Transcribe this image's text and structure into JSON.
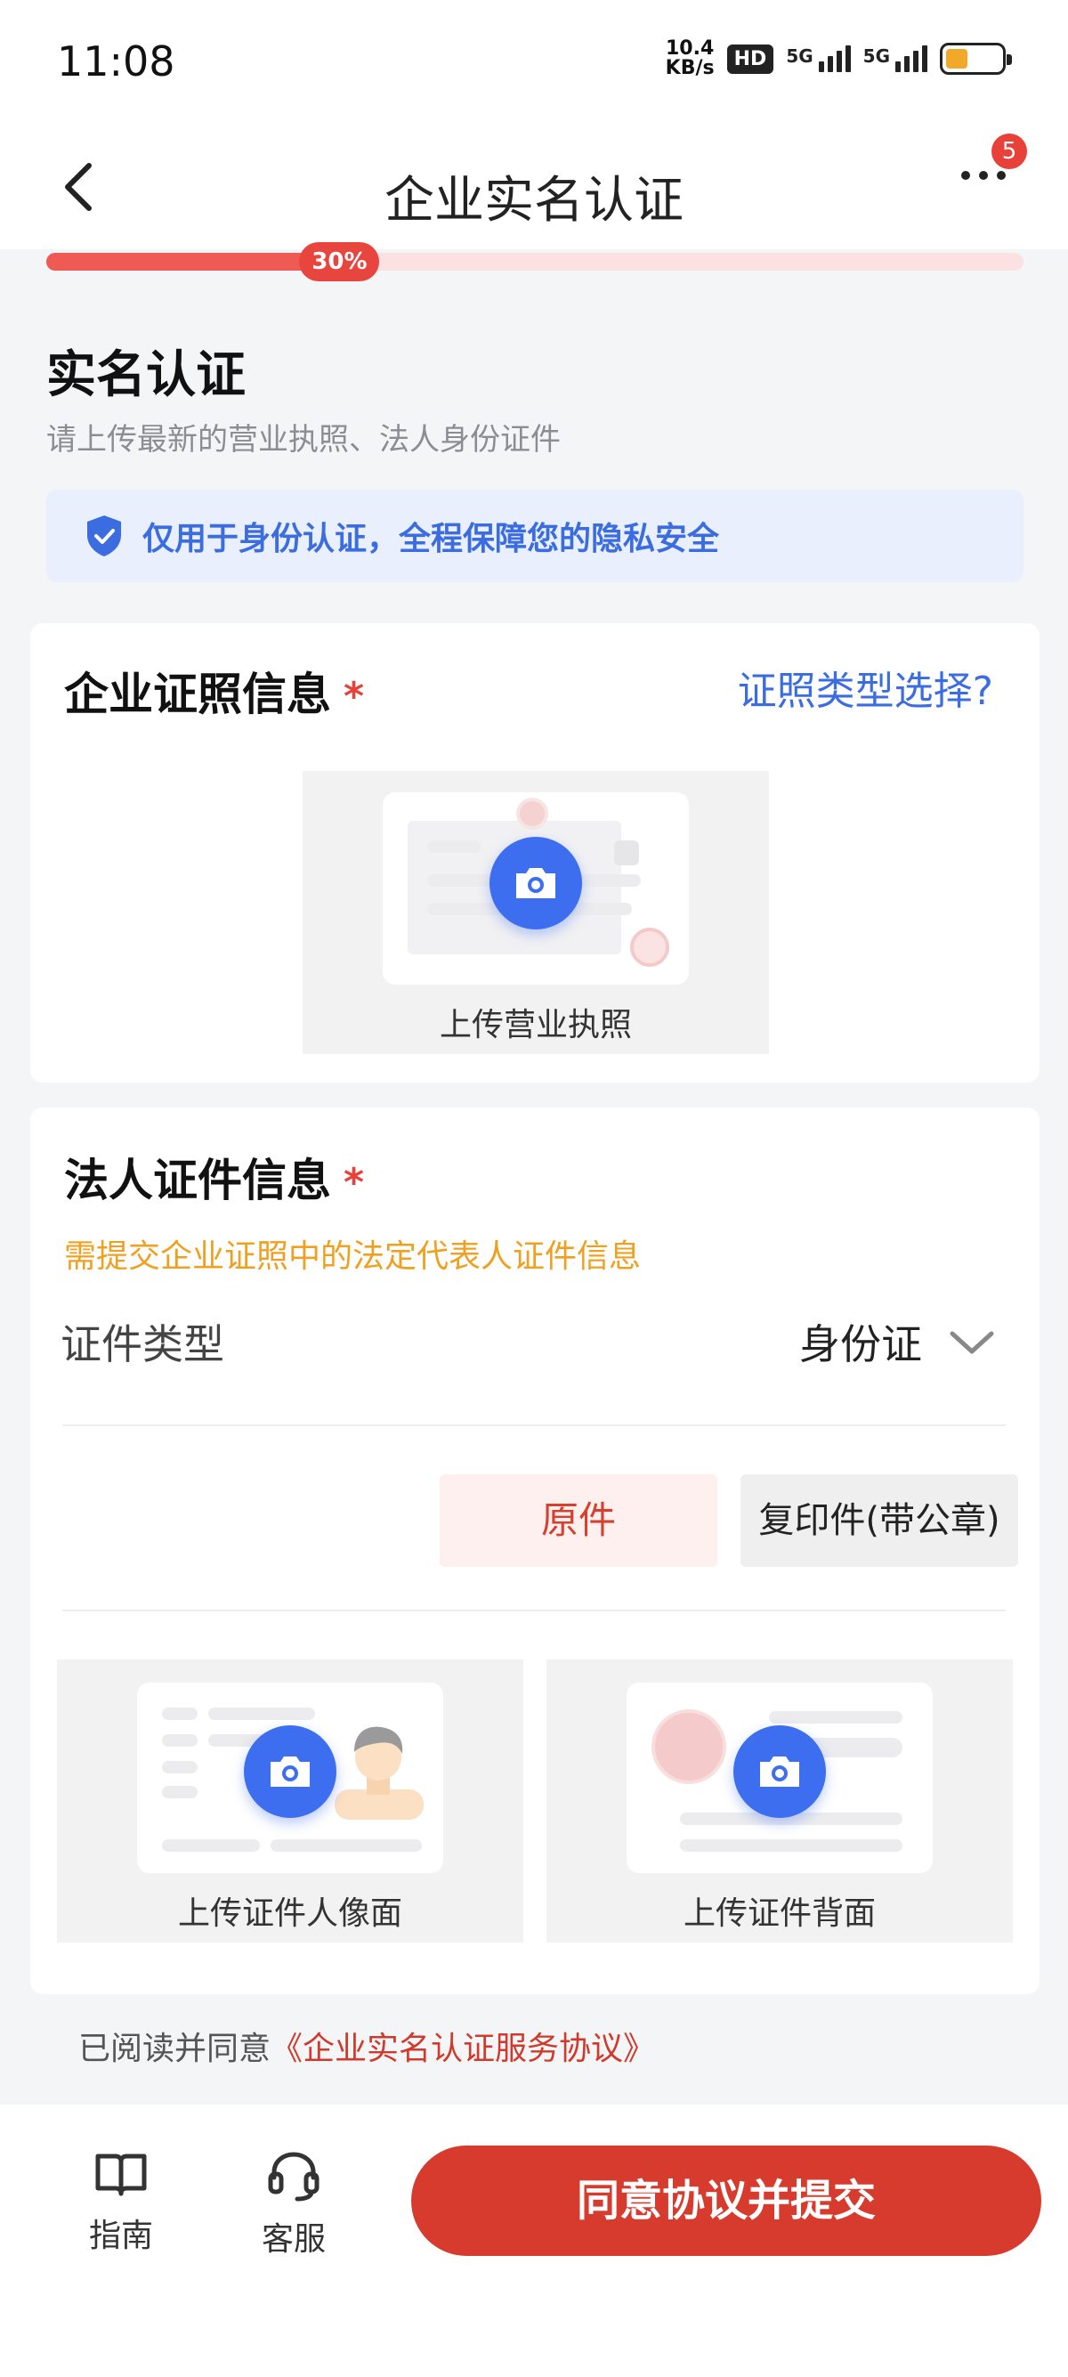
{
  "status_bar": {
    "time": "11:08",
    "net_speed_value": "10.4",
    "net_speed_unit": "KB/s",
    "hd_badge": "HD",
    "signal_1_label": "5G",
    "signal_2_label": "5G",
    "battery_color": "#f2a829"
  },
  "nav": {
    "title": "企业实名认证",
    "notification_count": "5",
    "back_icon": "chevron-left-icon",
    "more_icon": "more-dots-icon"
  },
  "progress": {
    "value": 0.3,
    "label": "30%"
  },
  "header": {
    "title": "实名认证",
    "subtitle": "请上传最新的营业执照、法人身份证件"
  },
  "privacy": {
    "text": "仅用于身份认证，全程保障您的隐私安全",
    "icon": "shield-check-icon"
  },
  "license_section": {
    "title": "企业证照信息",
    "required_mark": "*",
    "type_link": "证照类型选择?",
    "upload_label": "上传营业执照"
  },
  "legal_section": {
    "title": "法人证件信息",
    "required_mark": "*",
    "note": "需提交企业证照中的法定代表人证件信息",
    "cert_type_label": "证件类型",
    "cert_type_value": "身份证",
    "option_original": "原件",
    "option_copy": "复印件(带公章)",
    "upload_front_label": "上传证件人像面",
    "upload_back_label": "上传证件背面"
  },
  "agreement": {
    "prefix": "已阅读并同意",
    "link": "《企业实名认证服务协议》"
  },
  "bottom_bar": {
    "guide_label": "指南",
    "service_label": "客服",
    "submit_label": "同意协议并提交"
  },
  "colors": {
    "accent_red": "#d63b2e",
    "link_blue": "#3b6de0",
    "camera_blue": "#3d6ef0",
    "note_orange": "#f0a020"
  }
}
